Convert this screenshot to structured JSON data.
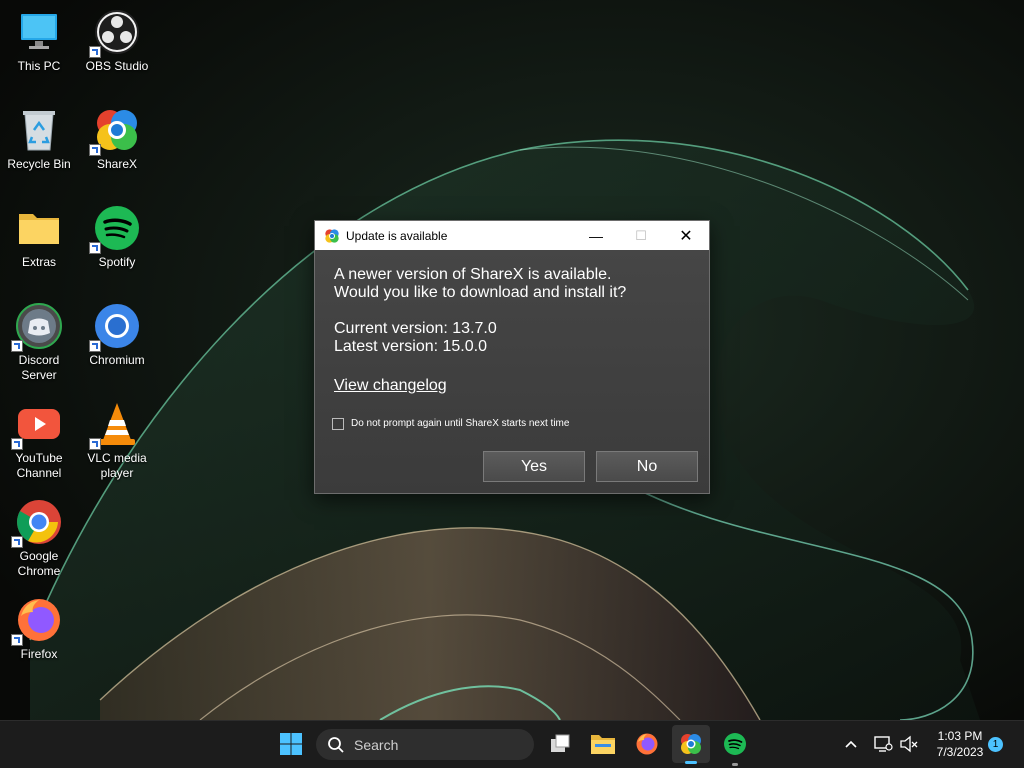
{
  "desktop": {
    "icons": [
      {
        "label": "This PC",
        "icon": "computer-icon"
      },
      {
        "label": "OBS Studio",
        "icon": "obs-icon"
      },
      {
        "label": "Recycle Bin",
        "icon": "recycle-bin-icon"
      },
      {
        "label": "ShareX",
        "icon": "sharex-icon"
      },
      {
        "label": "Extras",
        "icon": "folder-icon"
      },
      {
        "label": "Spotify",
        "icon": "spotify-icon"
      },
      {
        "label": "Discord Server",
        "icon": "discord-icon"
      },
      {
        "label": "Chromium",
        "icon": "chromium-icon"
      },
      {
        "label": "YouTube Channel",
        "icon": "youtube-icon"
      },
      {
        "label": "VLC media player",
        "icon": "vlc-icon"
      },
      {
        "label": "Google Chrome",
        "icon": "chrome-icon"
      },
      {
        "label": "Firefox",
        "icon": "firefox-icon"
      }
    ]
  },
  "dialog": {
    "title": "Update is available",
    "message_line1": "A newer version of ShareX is available.",
    "message_line2": "Would you like to download and install it?",
    "current_version": "Current version: 13.7.0",
    "latest_version": "Latest version: 15.0.0",
    "changelog_link": "View changelog",
    "checkbox_label": "Do not prompt again until ShareX starts next time",
    "checkbox_checked": false,
    "yes_label": "Yes",
    "no_label": "No",
    "minimize_symbol": "—",
    "maximize_symbol": "☐",
    "close_symbol": "✕"
  },
  "taskbar": {
    "search_label": "Search",
    "apps": [
      "start-icon",
      "task-view-icon",
      "file-explorer-icon",
      "firefox-icon",
      "sharex-icon",
      "spotify-icon"
    ],
    "tray": {
      "chevron": "^",
      "time": "1:03 PM",
      "date": "7/3/2023",
      "notification_count": "1"
    }
  },
  "colors": {
    "accent_blue": "#0078d4",
    "spotify_green": "#1db954"
  }
}
